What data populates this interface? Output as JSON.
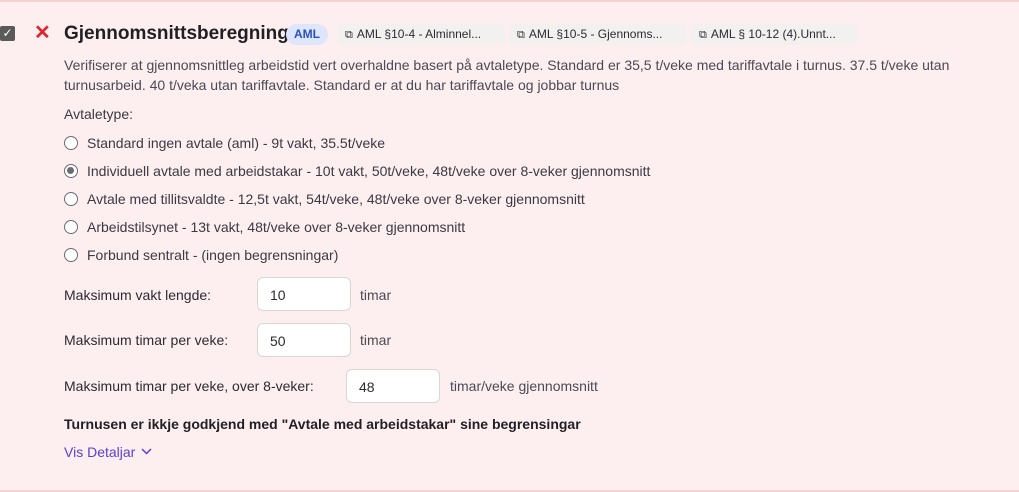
{
  "header": {
    "title": "Gjennomsnittsberegning",
    "badge": "AML",
    "refs": [
      "AML §10-4 - Alminnel...",
      "AML §10-5 - Gjennoms...",
      "AML § 10-12 (4).Unnt..."
    ]
  },
  "description": "Verifiserer at gjennomsnittleg arbeidstid vert overhaldne basert på avtaletype. Standard er 35,5 t/veke med tariffavtale i turnus. 37.5 t/veke utan turnusarbeid. 40 t/veka utan tariffavtale. Standard er at du har tariffavtale og jobbar turnus",
  "agreement": {
    "label": "Avtaletype:",
    "selected_index": 1,
    "options": [
      "Standard ingen avtale (aml) - 9t vakt, 35.5t/veke",
      "Individuell avtale med arbeidstakar - 10t vakt, 50t/veke, 48t/veke over 8-veker gjennomsnitt",
      "Avtale med tillitsvaldte - 12,5t vakt, 54t/veke, 48t/veke over 8-veker gjennomsnitt",
      "Arbeidstilsynet - 13t vakt, 48t/veke over 8-veker gjennomsnitt",
      "Forbund sentralt - (ingen begrensningar)"
    ]
  },
  "fields": {
    "max_shift": {
      "label": "Maksimum vakt lengde:",
      "value": "10",
      "unit": "timar"
    },
    "max_week": {
      "label": "Maksimum timar per veke:",
      "value": "50",
      "unit": "timar"
    },
    "max_week_avg": {
      "label": "Maksimum timar per veke, over 8-veker:",
      "value": "48",
      "unit": "timar/veke gjennomsnitt"
    }
  },
  "warning": "Turnusen er ikkje godkjend med \"Avtale med arbeidstakar\" sine begrensingar",
  "details_link": "Vis Detaljar",
  "icons": {
    "checkbox": "check-icon",
    "close": "close-icon",
    "external": "external-link-icon",
    "chevron": "chevron-down-icon"
  },
  "colors": {
    "background": "#fdefef",
    "close": "#e0242c",
    "badge_bg": "#dde6fb",
    "badge_text": "#2c4fbf",
    "link": "#5b3fd1"
  }
}
